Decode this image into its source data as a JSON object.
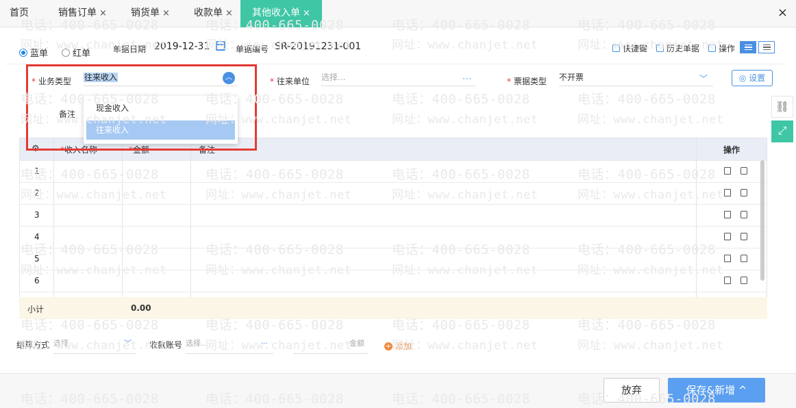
{
  "tabs": [
    {
      "label": "首页",
      "closable": false
    },
    {
      "label": "销售订单",
      "closable": true
    },
    {
      "label": "销货单",
      "closable": true
    },
    {
      "label": "收款单",
      "closable": true
    },
    {
      "label": "其他收入单",
      "closable": true,
      "active": true
    }
  ],
  "tab_close_glyph": "×",
  "window_close_glyph": "×",
  "header": {
    "radio_blue": "蓝单",
    "radio_red": "红单",
    "date_label": "单据日期",
    "date_value": "2019-12-31",
    "number_label": "单据编号",
    "number_value": "SR-20191231-001",
    "tools": {
      "shortcut": "快捷键",
      "history": "历史单据",
      "operation": "操作"
    }
  },
  "form": {
    "business_type_label": "业务类型",
    "business_type_value": "往来收入",
    "counterparty_label": "往来单位",
    "counterparty_placeholder": "选择...",
    "counterparty_more": "···",
    "invoice_type_label": "票据类型",
    "invoice_type_value": "不开票",
    "remark_label": "备注",
    "settings_label": "设置"
  },
  "dropdown": {
    "options": [
      "现金收入",
      "往来收入"
    ],
    "highlighted_index": 1
  },
  "grid": {
    "columns": [
      "收入名称",
      "金额",
      "备注",
      "操作"
    ],
    "rows": [
      "1",
      "2",
      "3",
      "4",
      "5",
      "6"
    ],
    "subtotal_label": "小计",
    "subtotal_amount": "0.00"
  },
  "settlement": {
    "method_label": "结算方式",
    "method_placeholder": "选择...",
    "account_label": "收款账号",
    "account_placeholder": "选择...",
    "account_more": "···",
    "amount_placeholder": "金额",
    "add_label": "添加"
  },
  "footer": {
    "cancel_label": "放弃",
    "save_label": "保存&新增 ^"
  },
  "watermark": {
    "phone": "电话：400-665-0028",
    "site": "网址：www.chanjet.net"
  },
  "colors": {
    "accent_tab": "#3ec6a5",
    "primary_blue": "#4a90e2",
    "required_red": "#e53935",
    "add_orange": "#f0883a",
    "save_button": "#5b9ff0"
  }
}
